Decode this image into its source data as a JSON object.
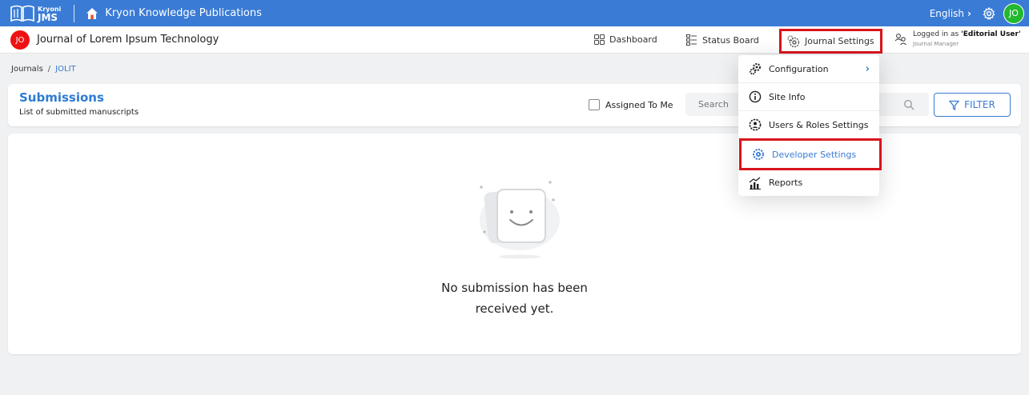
{
  "topbar": {
    "logo_small": "Kryoni",
    "logo_big": "JMS",
    "org_name": "Kryon Knowledge Publications",
    "language": "English",
    "avatar_initials": "JO"
  },
  "subbar": {
    "journal_badge": "JO",
    "journal_title": "Journal of Lorem Ipsum Technology",
    "nav": {
      "dashboard": "Dashboard",
      "status_board": "Status Board",
      "journal_settings": "Journal Settings"
    },
    "user": {
      "logged_prefix": "Logged in as ",
      "user_name": "'Editorial User'",
      "role": "Journal Manager"
    }
  },
  "breadcrumb": {
    "root": "Journals",
    "separator": "/",
    "current": "JOLIT"
  },
  "submissions": {
    "title": "Submissions",
    "subtitle": "List of submitted manuscripts",
    "assigned_label": "Assigned To Me",
    "search_placeholder": "Search",
    "filter_label": "FILTER"
  },
  "empty_state": {
    "line1": "No submission has been",
    "line2": "received yet."
  },
  "dropdown": {
    "items": [
      {
        "label": "Configuration",
        "icon": "config-gears-icon",
        "has_submenu": true
      },
      {
        "label": "Site Info",
        "icon": "info-icon"
      },
      {
        "label": "Users & Roles Settings",
        "icon": "users-roles-icon"
      },
      {
        "label": "Developer Settings",
        "icon": "developer-gear-icon",
        "highlighted": true
      },
      {
        "label": "Reports",
        "icon": "reports-chart-icon"
      }
    ]
  },
  "colors": {
    "brand_blue": "#3a7bd5",
    "highlight_red": "#d9141c",
    "avatar_green": "#22b830",
    "badge_red": "#ee1111"
  }
}
